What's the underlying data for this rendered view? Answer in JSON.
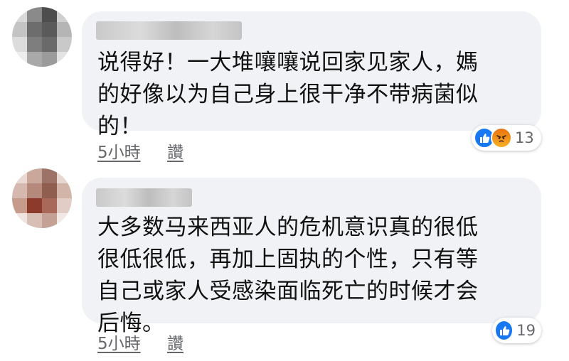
{
  "comments": [
    {
      "text_lines": [
        "说得好！一大堆嚷嚷说回家见家人，媽",
        "的好像以为自己身上很干净不带病菌似",
        "的！"
      ],
      "time": "5小時",
      "reply": "讚",
      "reactions": [
        "like",
        "angry"
      ],
      "reaction_count": "13"
    },
    {
      "text_lines": [
        "大多数马来西亚人的危机意识真的很低",
        "很低很低，再加上固执的个性，只有等",
        "自己或家人受感染面临死亡的时候才会",
        "后悔。"
      ],
      "time": "5小時",
      "reply": "讚",
      "reactions": [
        "like"
      ],
      "reaction_count": "19"
    }
  ],
  "colors": {
    "bubble": "#f0f2f5",
    "meta_text": "#65676b",
    "like": "#1877f2",
    "angry": "#f08a1b"
  }
}
